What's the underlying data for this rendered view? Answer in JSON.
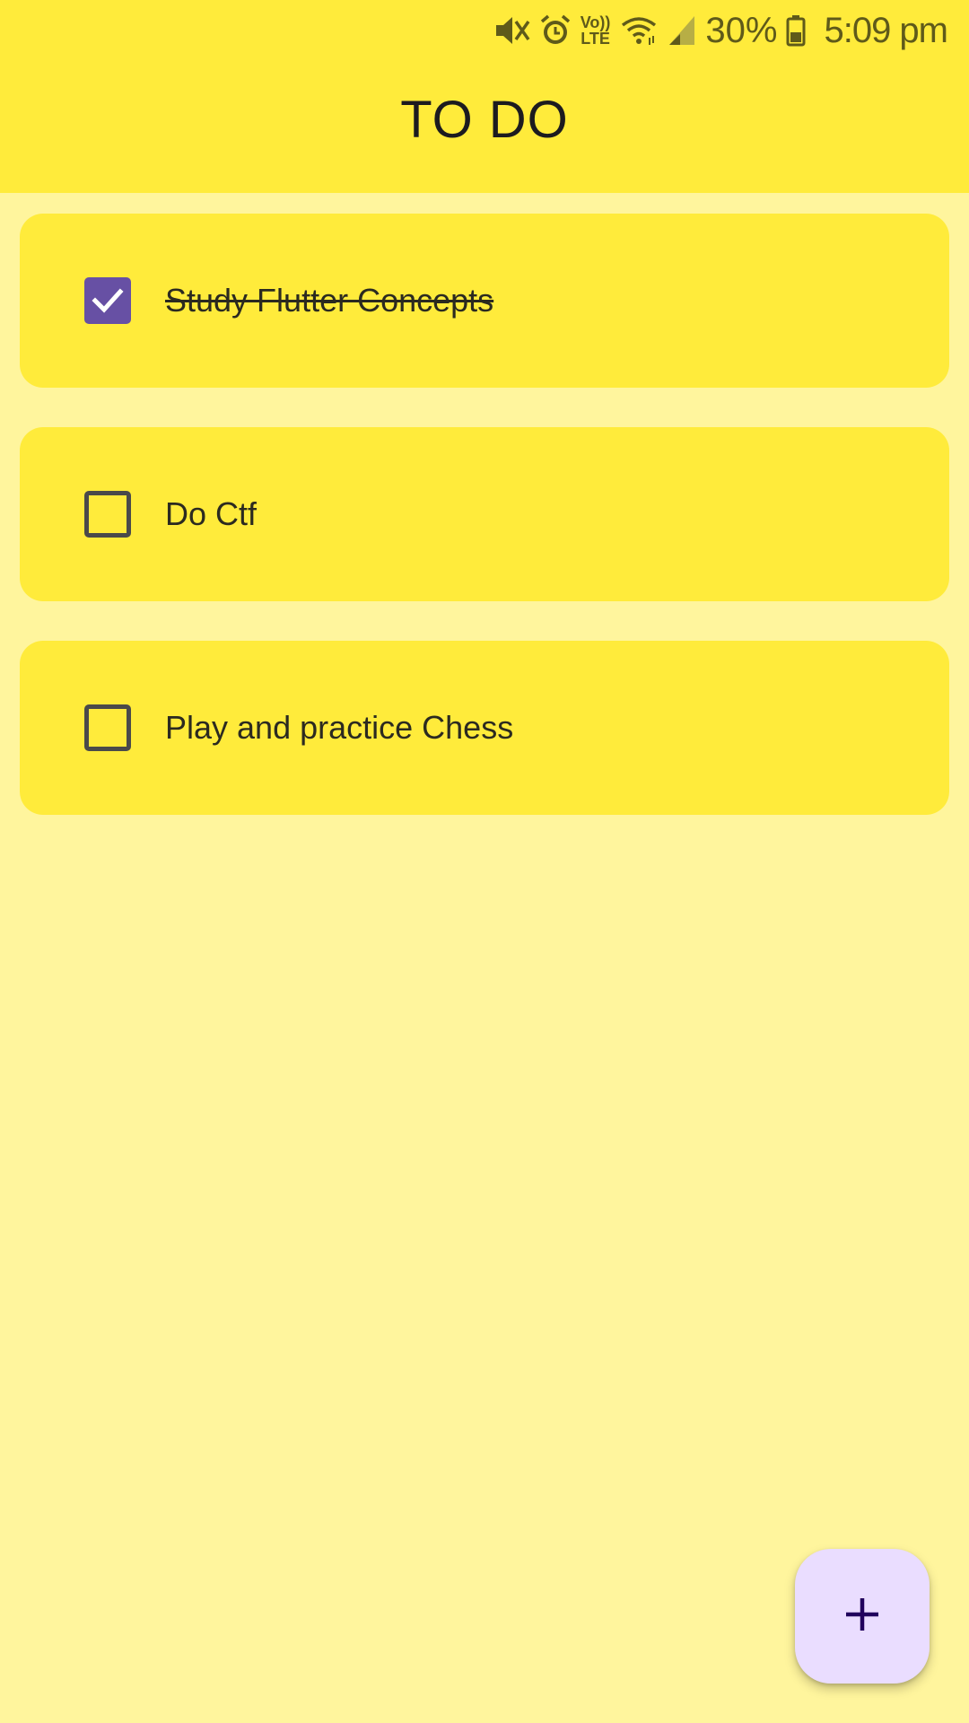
{
  "status_bar": {
    "battery_percent": "30%",
    "time": "5:09 pm",
    "icons": [
      "mute-icon",
      "alarm-icon",
      "volte-icon",
      "wifi-icon",
      "signal-icon",
      "battery-icon"
    ],
    "volte_label_top": "Vo))",
    "volte_label_bottom": "LTE"
  },
  "app_bar": {
    "title": "TO DO",
    "background_color": "#FFEB3B"
  },
  "tasks": [
    {
      "label": "Study Flutter Concepts",
      "checked": true
    },
    {
      "label": "Do Ctf",
      "checked": false
    },
    {
      "label": "Play and practice Chess",
      "checked": false
    }
  ],
  "fab": {
    "icon": "plus-icon",
    "color": "#EADDFF"
  },
  "colors": {
    "page_background": "#FFF59D",
    "card_background": "#FFEB3B",
    "checkbox_checked": "#6750A4"
  }
}
